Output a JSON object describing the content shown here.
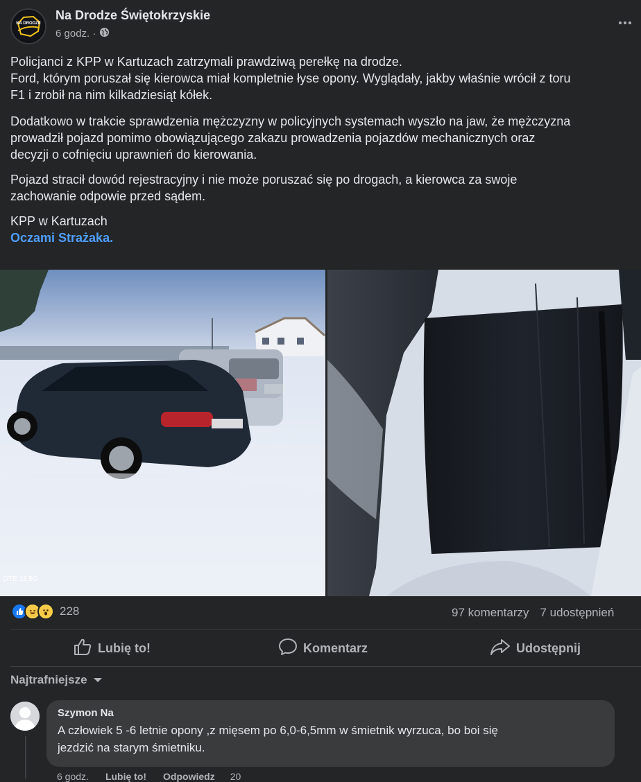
{
  "post": {
    "page_name": "Na Drodze Świętokrzyskie",
    "time": "6 godz. ·",
    "logo_text": "NA DRODZE",
    "paragraphs": [
      "Policjanci z KPP w Kartuzach zatrzymali prawdziwą perełkę na drodze.",
      "Ford, którym poruszał się kierowca miał kompletnie łyse opony. Wyglądały, jakby właśnie wrócił z toru",
      "F1 i zrobił na nim kilkadziesiąt kółek.",
      "Dodatkowo w trakcie sprawdzenia mężczyzny w policyjnych systemach wyszło na jaw, że mężczyzna",
      "prowadził pojazd pomimo obowiązującego zakazu prowadzenia pojazdów mechanicznych oraz",
      "decyzji o cofnięciu uprawnień do kierowania.",
      "Pojazd stracił dowód rejestracyjny i nie może poruszać się po drogach, a kierowca za swoje",
      "zachowanie odpowie przed sądem.",
      "KPP w Kartuzach"
    ],
    "link": "Oczami Strażaka.",
    "photo_watermark": "OTE 13 5G"
  },
  "stats": {
    "reaction_count": "228",
    "comments": "97 komentarzy",
    "shares": "7 udostępnień"
  },
  "actions": {
    "like": "Lubię to!",
    "comment": "Komentarz",
    "share": "Udostępnij"
  },
  "comments_section": {
    "sort_label": "Najtrafniejsze",
    "items": [
      {
        "author": "Szymon Na",
        "line1": "A człowiek 5 -6 letnie opony ,z mięsem po 6,0-6,5mm w śmietnik wyrzuca, bo boi się",
        "line2": "jezdzić na starym śmietniku.",
        "time": "6 godz.",
        "like": "Lubię to!",
        "reply": "Odpowiedz",
        "reactions": "20"
      }
    ]
  },
  "colors": {
    "background": "#242526",
    "link": "#4d9eff",
    "like_blue": "#1877f2"
  }
}
